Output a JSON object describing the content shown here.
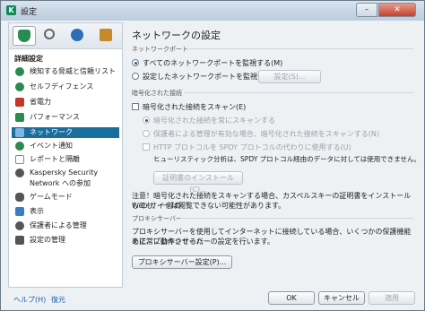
{
  "window": {
    "title": "設定",
    "minimize": "–",
    "close": "✕"
  },
  "sidebar": {
    "toolbar": [
      {
        "name": "protection-icon",
        "color": "#2a8a4f"
      },
      {
        "name": "scan-icon",
        "color": "#666"
      },
      {
        "name": "update-icon",
        "color": "#2d6fb3"
      },
      {
        "name": "tools-icon",
        "color": "#c58a2a"
      }
    ],
    "section": "詳細設定",
    "items": [
      {
        "label": "検知する脅威と信頼リスト",
        "color": "#2a8a4f"
      },
      {
        "label": "セルフディフェンス",
        "color": "#2a8a4f"
      },
      {
        "label": "省電力",
        "color": "#c0392b"
      },
      {
        "label": "パフォーマンス",
        "color": "#2a8a4f"
      },
      {
        "label": "ネットワーク",
        "color": "#3b7dc2"
      },
      {
        "label": "イベント通知",
        "color": "#2a8a4f"
      },
      {
        "label": "レポートと隔離",
        "color": "#888"
      },
      {
        "label": "Kaspersky Security",
        "label2": "Network への参加",
        "color": "#555"
      },
      {
        "label": "ゲームモード",
        "color": "#555"
      },
      {
        "label": "表示",
        "color": "#3b7dc2"
      },
      {
        "label": "保護者による管理",
        "color": "#555"
      },
      {
        "label": "設定の管理",
        "color": "#555"
      }
    ]
  },
  "main": {
    "title": "ネットワークの設定",
    "ports_group": "ネットワークポート",
    "all_ports": "すべてのネットワークポートを監視する(M)",
    "selected_ports": "設定したネットワークポートを監視する",
    "settings_btn": "設定(S)...",
    "encrypted_group": "暗号化された接続",
    "scan_encrypted": "暗号化された接続をスキャン(E)",
    "always_scan": "暗号化された接続を常にスキャンする",
    "parental_scan": "保護者による管理が有効な場合、暗号化された接続をスキャンする(N)",
    "spdy_label": "HTTP プロトコルを SPDY プロトコルの代わりに使用する(U)",
    "spdy_note": "ヒューリスティック分析は、SPDY プロトコル経由のデータに対しては使用できません。",
    "cert_btn": "証明書のインストール(C)...",
    "warning_line1": "注意！暗号化された接続をスキャンする場合、カスペルスキーの証明書をインストールしても、一部の",
    "warning_line2": "Web サイトは閲覧できない可能性があります。",
    "proxy_group": "プロキシサーバー",
    "proxy_line1": "プロキシサーバーを使用してインターネットに接続している場合、いくつかの保護機能を正常に動作させるた",
    "proxy_line2": "めに、プロキシサーバーの設定を行います。",
    "proxy_btn": "プロキシサーバー設定(P)..."
  },
  "footer": {
    "help": "ヘルプ(H)",
    "restore": "復元",
    "ok": "OK",
    "cancel": "キャンセル",
    "apply": "適用"
  }
}
